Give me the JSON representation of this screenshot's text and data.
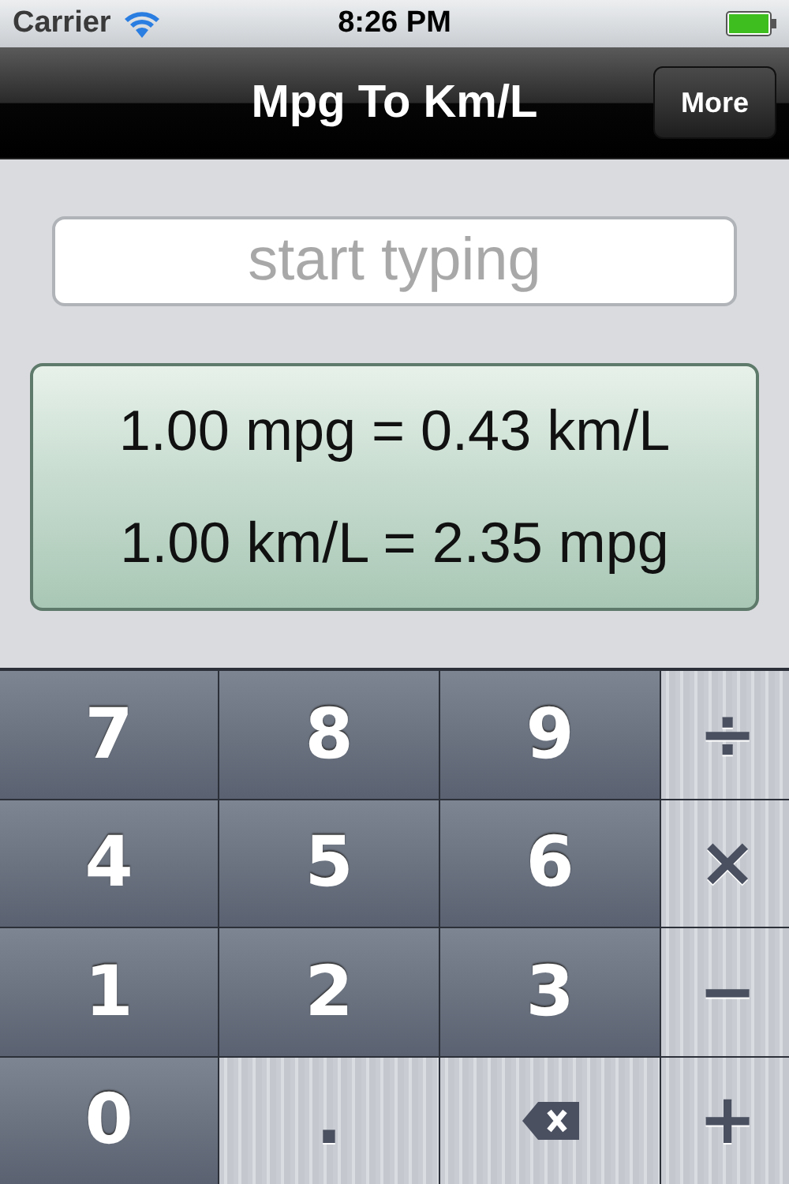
{
  "status_bar": {
    "carrier": "Carrier",
    "time": "8:26 PM"
  },
  "nav_bar": {
    "title": "Mpg To Km/L",
    "button": "More"
  },
  "input": {
    "placeholder": "start typing"
  },
  "results": [
    "1.00 mpg = 0.43 km/L",
    "1.00 km/L = 2.35 mpg"
  ],
  "keys": [
    {
      "label": "7",
      "kind": "digit"
    },
    {
      "label": "8",
      "kind": "digit"
    },
    {
      "label": "9",
      "kind": "digit"
    },
    {
      "label": "÷",
      "kind": "operator"
    },
    {
      "label": "4",
      "kind": "digit"
    },
    {
      "label": "5",
      "kind": "digit"
    },
    {
      "label": "6",
      "kind": "digit"
    },
    {
      "label": "×",
      "kind": "operator"
    },
    {
      "label": "1",
      "kind": "digit"
    },
    {
      "label": "2",
      "kind": "digit"
    },
    {
      "label": "3",
      "kind": "digit"
    },
    {
      "label": "−",
      "kind": "operator"
    },
    {
      "label": "0",
      "kind": "digit"
    },
    {
      "label": ".",
      "kind": "operator"
    },
    {
      "kind": "backspace"
    },
    {
      "label": "+",
      "kind": "operator"
    }
  ]
}
